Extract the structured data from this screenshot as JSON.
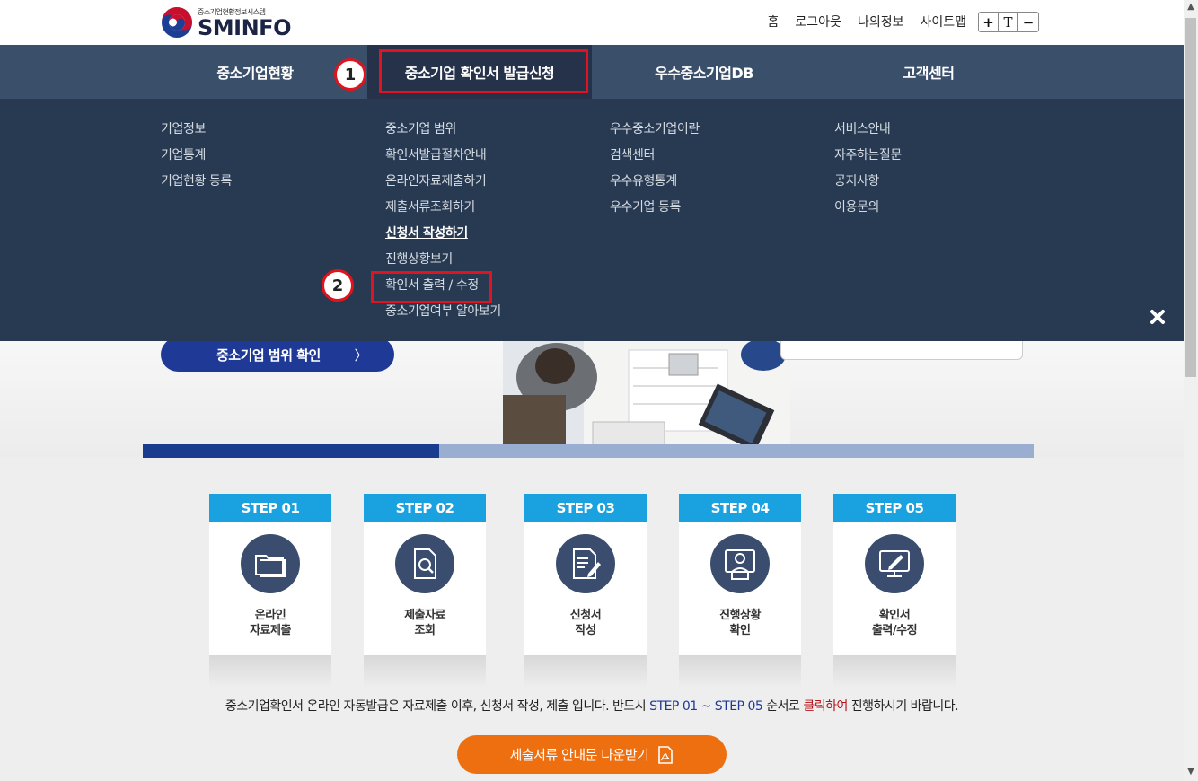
{
  "header": {
    "logo_sub": "중소기업현황정보시스템",
    "logo_main": "SMINFO",
    "links": [
      "홈",
      "로그아웃",
      "나의정보",
      "사이트맵"
    ],
    "font_controls": [
      "+",
      "T",
      "−"
    ]
  },
  "gnb": {
    "items": [
      "중소기업현황",
      "중소기업 확인서 발급신청",
      "우수중소기업DB",
      "고객센터"
    ]
  },
  "mega": {
    "col1": [
      "기업정보",
      "기업통계",
      "기업현황 등록"
    ],
    "col2": [
      "중소기업 범위",
      "확인서발급절차안내",
      "온라인자료제출하기",
      "제출서류조회하기",
      "신청서 작성하기",
      "진행상황보기",
      "확인서 출력 / 수정",
      "중소기업여부 알아보기"
    ],
    "col3": [
      "우수중소기업이란",
      "검색센터",
      "우수유형통계",
      "우수기업 등록"
    ],
    "col4": [
      "서비스안내",
      "자주하는질문",
      "공지사항",
      "이용문의"
    ]
  },
  "annotations": [
    "1",
    "2"
  ],
  "hero": {
    "scope_button": "중소기업 범위 확인",
    "chevron": "〉"
  },
  "steps": [
    {
      "head": "STEP 01",
      "line1": "온라인",
      "line2": "자료제출",
      "icon": "folder-icon"
    },
    {
      "head": "STEP 02",
      "line1": "제출자료",
      "line2": "조회",
      "icon": "document-search-icon"
    },
    {
      "head": "STEP 03",
      "line1": "신청서",
      "line2": "작성",
      "icon": "document-write-icon"
    },
    {
      "head": "STEP 04",
      "line1": "진행상황",
      "line2": "확인",
      "icon": "monitor-person-icon"
    },
    {
      "head": "STEP 05",
      "line1": "확인서",
      "line2": "출력/수정",
      "icon": "monitor-edit-icon"
    }
  ],
  "notice": {
    "part1": "중소기업확인서 온라인 자동발급은 자료제출 이후, 신청서 작성, 제출 입니다. 반드시 ",
    "part2": "STEP 01 ~ STEP 05",
    "part3": " 순서로 ",
    "part4": "클릭하여",
    "part5": " 진행하시기 바랍니다."
  },
  "download_button": "제출서류 안내문 다운받기",
  "colors": {
    "nav": "#3a4f6a",
    "nav_active": "#25324a",
    "mega": "#283a52",
    "step_head": "#1aa1e0",
    "annotation": "#e0141e",
    "download": "#ee6f10",
    "scope": "#1f3a96"
  }
}
